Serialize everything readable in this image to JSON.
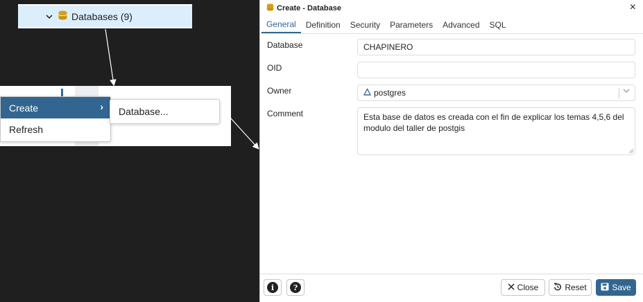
{
  "tree": {
    "databases_label": "Databases (9)"
  },
  "context_menu": {
    "items": [
      {
        "label": "Create",
        "submenu_arrow": "›"
      },
      {
        "label": "Refresh"
      }
    ],
    "submenu_item": "Database..."
  },
  "dialog": {
    "title": "Create - Database",
    "close_glyph": "×",
    "tabs": [
      "General",
      "Definition",
      "Security",
      "Parameters",
      "Advanced",
      "SQL"
    ],
    "active_tab": "General",
    "fields": {
      "database": {
        "label": "Database",
        "value": "CHAPINERO"
      },
      "oid": {
        "label": "OID",
        "value": ""
      },
      "owner": {
        "label": "Owner",
        "value": "postgres"
      },
      "comment": {
        "label": "Comment",
        "value": "Esta base de datos es creada con el fin de explicar los temas 4,5,6 del modulo del taller de postgis"
      }
    },
    "footer": {
      "info_glyph": "i",
      "help_glyph": "?",
      "close_label": "Close",
      "reset_label": "Reset",
      "save_label": "Save"
    }
  },
  "colors": {
    "accent": "#326690",
    "selection_bg": "#dceefc",
    "db_icon": "#d4a017",
    "page_bg": "#1f1f1f"
  },
  "icons": [
    "chevron-down-icon",
    "database-icon",
    "chevron-right-icon",
    "close-icon",
    "user-icon",
    "info-icon",
    "help-icon",
    "reset-icon",
    "save-icon",
    "resize-grip-icon"
  ]
}
